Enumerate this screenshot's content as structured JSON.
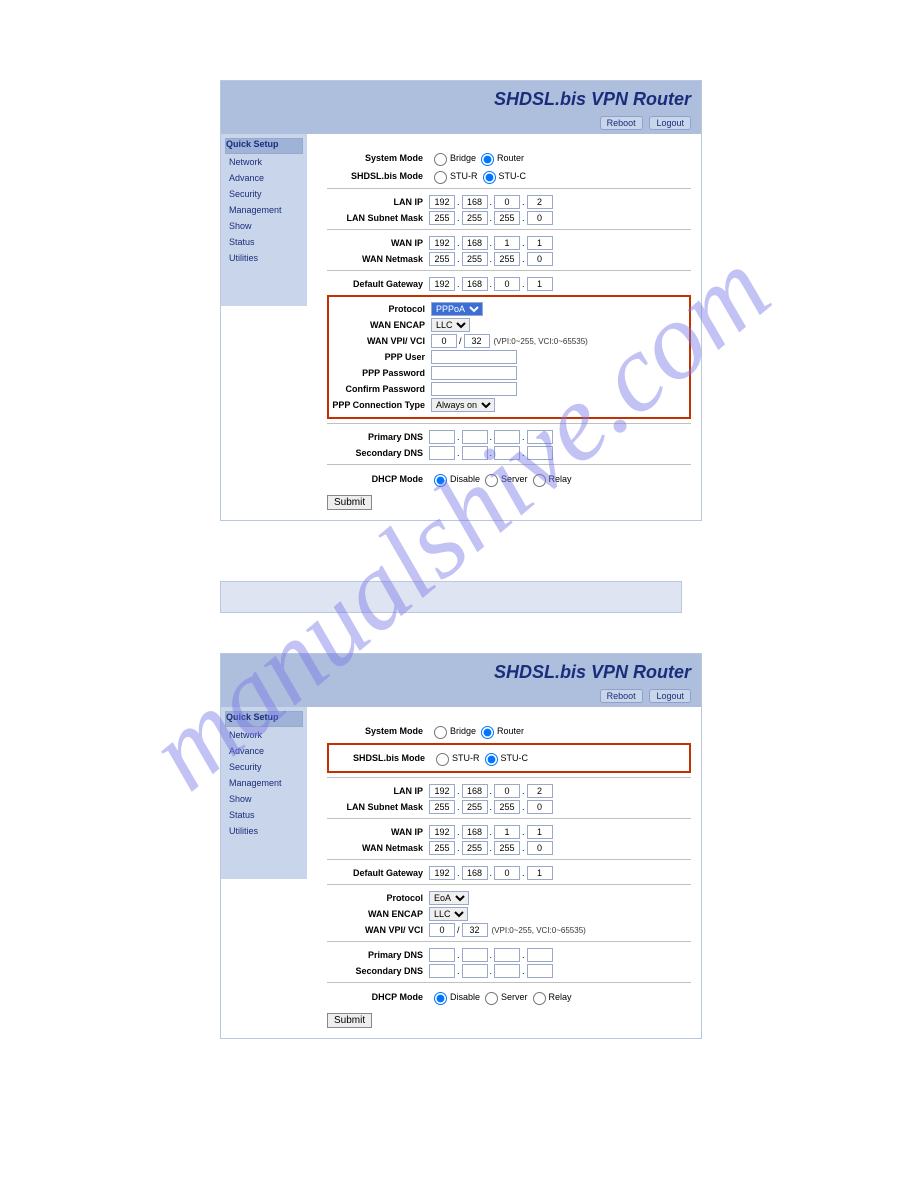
{
  "watermark": "manualshive.com",
  "header": {
    "title": "SHDSL.bis VPN Router",
    "reboot": "Reboot",
    "logout": "Logout"
  },
  "sidebar": {
    "items": [
      "Quick Setup",
      "Network",
      "Advance",
      "Security",
      "Management",
      "Show",
      "Status",
      "Utilities"
    ]
  },
  "labels": {
    "systemMode": "System Mode",
    "shdslMode": "SHDSL.bis Mode",
    "lanIp": "LAN IP",
    "lanMask": "LAN Subnet Mask",
    "wanIp": "WAN IP",
    "wanMask": "WAN Netmask",
    "gateway": "Default Gateway",
    "protocol": "Protocol",
    "encap": "WAN ENCAP",
    "vpivci": "WAN VPI/ VCI",
    "pppUser": "PPP User",
    "pppPass": "PPP Password",
    "confirmPass": "Confirm Password",
    "pppConn": "PPP Connection Type",
    "pDns": "Primary DNS",
    "sDns": "Secondary DNS",
    "dhcp": "DHCP Mode",
    "bridge": "Bridge",
    "router": "Router",
    "stur": "STU-R",
    "stuc": "STU-C",
    "disable": "Disable",
    "server": "Server",
    "relay": "Relay",
    "submit": "Submit",
    "vpihint": "(VPI:0~255, VCI:0~65535)"
  },
  "shot1": {
    "lanIp": [
      "192",
      "168",
      "0",
      "2"
    ],
    "lanMask": [
      "255",
      "255",
      "255",
      "0"
    ],
    "wanIp": [
      "192",
      "168",
      "1",
      "1"
    ],
    "wanMask": [
      "255",
      "255",
      "255",
      "0"
    ],
    "gateway": [
      "192",
      "168",
      "0",
      "1"
    ],
    "protocol": "PPPoA",
    "encap": "LLC",
    "vpi": "0",
    "vci": "32",
    "pppConn": "Always on"
  },
  "shot2": {
    "lanIp": [
      "192",
      "168",
      "0",
      "2"
    ],
    "lanMask": [
      "255",
      "255",
      "255",
      "0"
    ],
    "wanIp": [
      "192",
      "168",
      "1",
      "1"
    ],
    "wanMask": [
      "255",
      "255",
      "255",
      "0"
    ],
    "gateway": [
      "192",
      "168",
      "0",
      "1"
    ],
    "protocol": "EoA",
    "encap": "LLC",
    "vpi": "0",
    "vci": "32"
  }
}
